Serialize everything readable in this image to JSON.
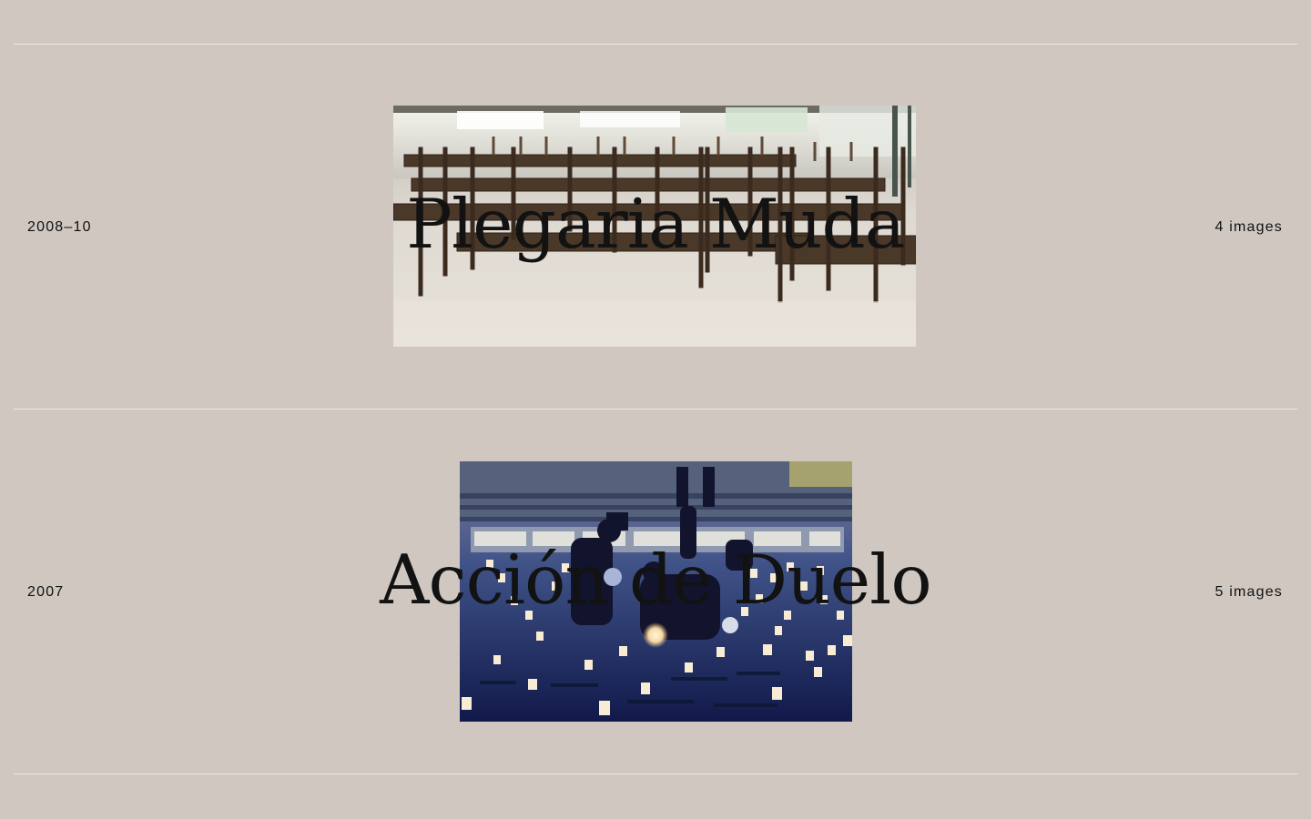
{
  "projects": [
    {
      "years": "2008–10",
      "title": "Plegaria Muda",
      "image_count": "4 images",
      "image_icon": "empty-wooden-tables-gallery-photo"
    },
    {
      "years": "2007",
      "title": "Acción de Duelo",
      "image_count": "5 images",
      "image_icon": "candlelight-vigil-plaza-photo"
    }
  ],
  "colors": {
    "background": "#cfc7c0",
    "rule": "#f1ece7",
    "text": "#111111"
  }
}
